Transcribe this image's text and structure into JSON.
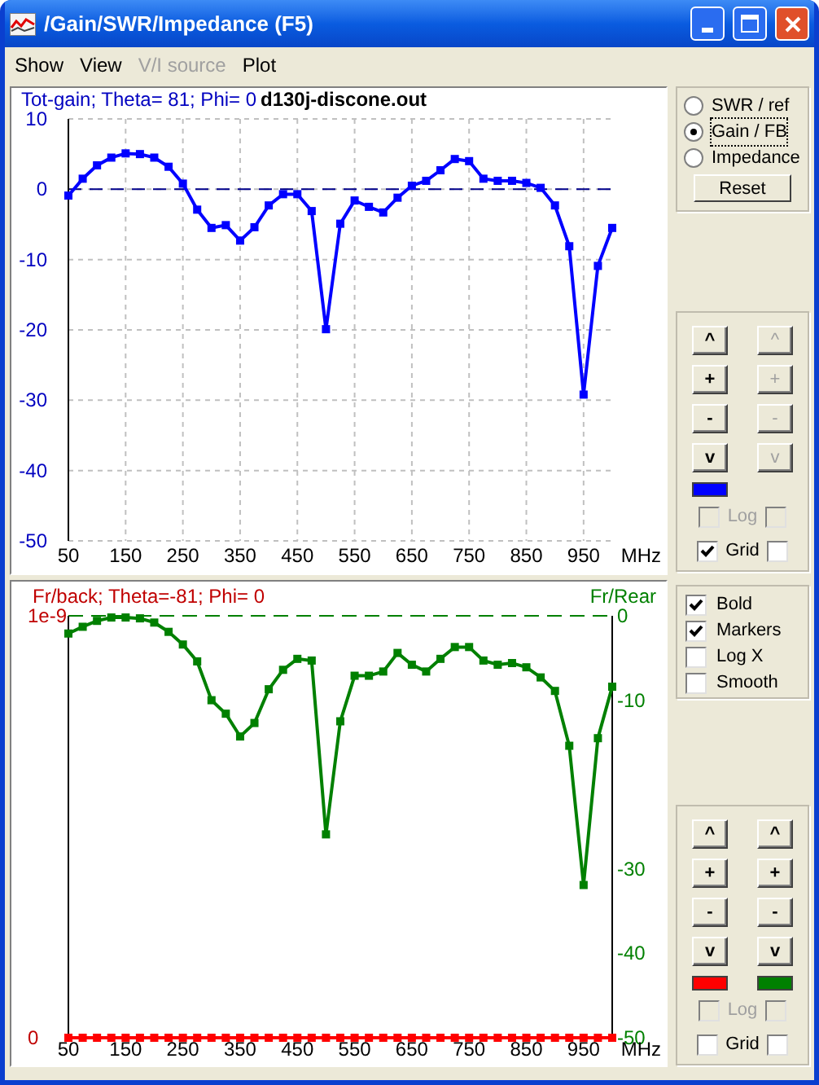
{
  "window": {
    "title": "/Gain/SWR/Impedance (F5)"
  },
  "menu": [
    {
      "label": "Show",
      "disabled": false
    },
    {
      "label": "View",
      "disabled": false
    },
    {
      "label": "V/I source",
      "disabled": true
    },
    {
      "label": "Plot",
      "disabled": false
    }
  ],
  "top_chart": {
    "file": "d130j-discone.out",
    "chart_data": {
      "type": "line",
      "title": "Tot-gain; Theta= 81; Phi= 0",
      "grid": true,
      "ref_lines": [
        {
          "axis": "y",
          "value": 0,
          "color": "#00008b"
        }
      ],
      "xlabel": "MHz",
      "x": [
        50,
        75,
        100,
        125,
        150,
        175,
        200,
        225,
        250,
        275,
        300,
        325,
        350,
        375,
        400,
        425,
        450,
        475,
        500,
        525,
        550,
        575,
        600,
        625,
        650,
        675,
        700,
        725,
        750,
        775,
        800,
        825,
        850,
        875,
        900,
        925,
        950,
        975,
        1000
      ],
      "xlim": [
        50,
        1000
      ],
      "ylim": [
        -50,
        10
      ],
      "xticks": [
        50,
        150,
        250,
        350,
        450,
        550,
        650,
        750,
        850,
        950
      ],
      "yticks": [
        10,
        0,
        -10,
        -20,
        -30,
        -40,
        -50
      ],
      "series": [
        {
          "color": "#0000ff",
          "marker": "square",
          "values": [
            -0.9,
            1.5,
            3.4,
            4.5,
            5.1,
            5.0,
            4.5,
            3.2,
            0.8,
            -2.9,
            -5.5,
            -5.1,
            -7.3,
            -5.4,
            -2.3,
            -0.7,
            -0.7,
            -3.1,
            -19.9,
            -4.9,
            -1.6,
            -2.5,
            -3.3,
            -1.2,
            0.5,
            1.2,
            2.7,
            4.3,
            4.0,
            1.5,
            1.2,
            1.2,
            0.9,
            0.2,
            -2.3,
            -8.1,
            -29.2,
            -10.9,
            -5.5
          ]
        }
      ]
    }
  },
  "bottom_chart": {
    "chart_data": {
      "type": "line",
      "title": "Fr/back; Theta=-81; Phi= 0",
      "y2lim": [
        0,
        1e-09
      ],
      "y2ticks": [
        {
          "value": 1e-09,
          "label": "1e-9"
        },
        {
          "value": 0,
          "label": "0"
        }
      ],
      "xlabel": "MHz",
      "ylabel": "Fr/Rear",
      "x": [
        50,
        75,
        100,
        125,
        150,
        175,
        200,
        225,
        250,
        275,
        300,
        325,
        350,
        375,
        400,
        425,
        450,
        475,
        500,
        525,
        550,
        575,
        600,
        625,
        650,
        675,
        700,
        725,
        750,
        775,
        800,
        825,
        850,
        875,
        900,
        925,
        950,
        975,
        1000
      ],
      "xlim": [
        50,
        1000
      ],
      "ylim": [
        -50,
        0
      ],
      "xticks": [
        50,
        150,
        250,
        350,
        450,
        550,
        650,
        750,
        850,
        950
      ],
      "yticks": [
        0,
        -10,
        -30,
        -40,
        -50
      ],
      "series": [
        {
          "color": "#008000",
          "marker": "square",
          "values": [
            -2.1,
            -1.3,
            -0.6,
            -0.2,
            -0.2,
            -0.3,
            -0.8,
            -1.9,
            -3.4,
            -5.4,
            -10.0,
            -11.6,
            -14.3,
            -12.7,
            -8.7,
            -6.4,
            -5.1,
            -5.3,
            -25.9,
            -12.5,
            -7.1,
            -7.1,
            -6.6,
            -4.4,
            -5.8,
            -6.6,
            -5.1,
            -3.7,
            -3.7,
            -5.3,
            -5.8,
            -5.6,
            -6.1,
            -7.3,
            -8.9,
            -15.4,
            -31.9,
            -14.5,
            -8.4
          ]
        },
        {
          "color": "#ff0000",
          "marker": "square",
          "axis": "y2",
          "values": [
            0,
            0,
            0,
            0,
            0,
            0,
            0,
            0,
            0,
            0,
            0,
            0,
            0,
            0,
            0,
            0,
            0,
            0,
            0,
            0,
            0,
            0,
            0,
            0,
            0,
            0,
            0,
            0,
            0,
            0,
            0,
            0,
            0,
            0,
            0,
            0,
            0,
            0,
            0
          ]
        }
      ]
    }
  },
  "mode_group": {
    "options": [
      {
        "label": "SWR / ref",
        "selected": false
      },
      {
        "label": "Gain / FB",
        "selected": true
      },
      {
        "label": "Impedance",
        "selected": false
      }
    ],
    "reset": "Reset"
  },
  "top_axis_controls": {
    "columns": [
      {
        "buttons": [
          "^",
          "+",
          "-",
          "v"
        ],
        "disabled": false,
        "color": "#0000ff"
      },
      {
        "buttons": [
          "^",
          "+",
          "-",
          "v"
        ],
        "disabled": true
      }
    ],
    "log": {
      "label": "Log",
      "disabled": true,
      "checks": [
        false,
        false
      ]
    },
    "grid": {
      "label": "Grid",
      "disabled": false,
      "checks": [
        true,
        false
      ]
    }
  },
  "options_group": [
    {
      "label": "Bold",
      "checked": true
    },
    {
      "label": "Markers",
      "checked": true
    },
    {
      "label": "Log X",
      "checked": false
    },
    {
      "label": "Smooth",
      "checked": false
    }
  ],
  "bottom_axis_controls": {
    "columns": [
      {
        "buttons": [
          "^",
          "+",
          "-",
          "v"
        ],
        "disabled": false,
        "color": "#ff0000"
      },
      {
        "buttons": [
          "^",
          "+",
          "-",
          "v"
        ],
        "disabled": false,
        "color": "#008000"
      }
    ],
    "log": {
      "label": "Log",
      "disabled": true,
      "checks": [
        false,
        false
      ]
    },
    "grid": {
      "label": "Grid",
      "disabled": false,
      "checks": [
        false,
        false
      ]
    }
  }
}
